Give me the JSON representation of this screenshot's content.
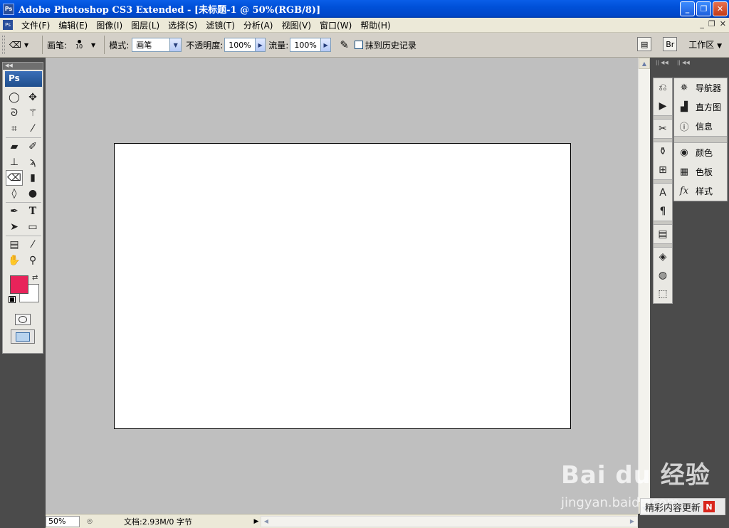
{
  "window": {
    "title": "Adobe Photoshop CS3 Extended - [未标题-1 @ 50%(RGB/8)]",
    "app_icon": "Ps"
  },
  "menu": {
    "items": [
      "文件(F)",
      "编辑(E)",
      "图像(I)",
      "图层(L)",
      "选择(S)",
      "滤镜(T)",
      "分析(A)",
      "视图(V)",
      "窗口(W)",
      "帮助(H)"
    ]
  },
  "options": {
    "brush_label": "画笔:",
    "brush_size": "10",
    "mode_label": "模式:",
    "mode_value": "画笔",
    "opacity_label": "不透明度:",
    "opacity_value": "100%",
    "flow_label": "流量:",
    "flow_value": "100%",
    "erase_history_label": "抹到历史记录",
    "workspace_label": "工作区"
  },
  "tools": {
    "logo": "Ps",
    "foreground_color": "#e8235a",
    "background_color": "#ffffff"
  },
  "panels": {
    "items": [
      {
        "label": "导航器",
        "icon": "navigator-icon"
      },
      {
        "label": "直方图",
        "icon": "histogram-icon"
      },
      {
        "label": "信息",
        "icon": "info-icon"
      },
      {
        "label": "颜色",
        "icon": "color-icon"
      },
      {
        "label": "色板",
        "icon": "swatches-icon"
      },
      {
        "label": "样式",
        "icon": "styles-icon"
      }
    ]
  },
  "status": {
    "zoom": "50%",
    "doc_info": "文档:2.93M/0 字节"
  },
  "watermark": {
    "logo": "Bai du 经验",
    "url": "jingyan.baidu.com",
    "badge": "精彩内容更新",
    "badge_mark": "N"
  }
}
